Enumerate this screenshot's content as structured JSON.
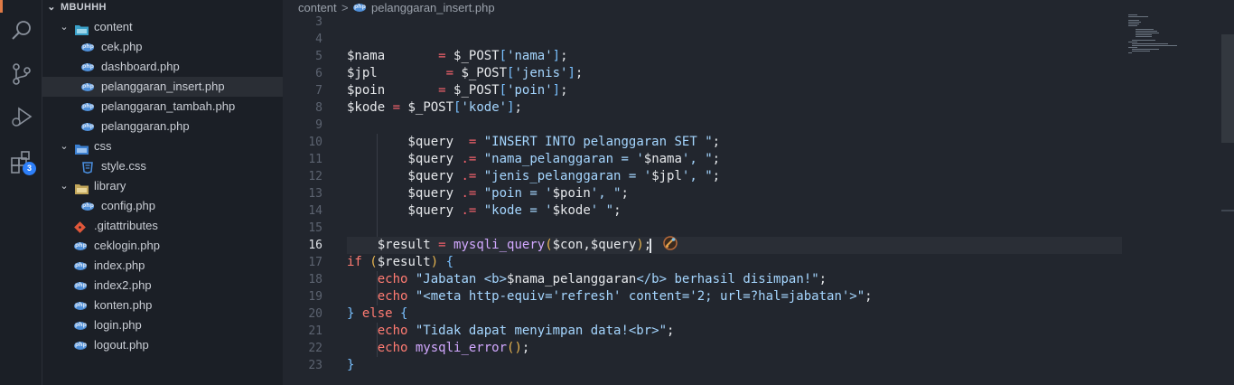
{
  "activity_bar": {
    "icons": [
      "files-icon",
      "search-icon",
      "source-control-icon",
      "run-debug-icon",
      "extensions-icon"
    ],
    "extensions_badge": "3"
  },
  "explorer": {
    "root": "MBUHHH",
    "items": [
      {
        "label": "content",
        "type": "folder",
        "icon": "folder-icon"
      },
      {
        "label": "cek.php",
        "type": "php"
      },
      {
        "label": "dashboard.php",
        "type": "php"
      },
      {
        "label": "pelanggaran_insert.php",
        "type": "php",
        "selected": true
      },
      {
        "label": "pelanggaran_tambah.php",
        "type": "php"
      },
      {
        "label": "pelanggaran.php",
        "type": "php"
      },
      {
        "label": "css",
        "type": "folder"
      },
      {
        "label": "style.css",
        "type": "css"
      },
      {
        "label": "library",
        "type": "folder"
      },
      {
        "label": "config.php",
        "type": "php"
      },
      {
        "label": ".gitattributes",
        "type": "git"
      },
      {
        "label": "ceklogin.php",
        "type": "php"
      },
      {
        "label": "index.php",
        "type": "php"
      },
      {
        "label": "index2.php",
        "type": "php"
      },
      {
        "label": "konten.php",
        "type": "php"
      },
      {
        "label": "login.php",
        "type": "php"
      },
      {
        "label": "logout.php",
        "type": "php"
      }
    ]
  },
  "breadcrumb": {
    "folder": "content",
    "separator": ">",
    "file": "pelanggaran_insert.php"
  },
  "editor": {
    "active_line": "16",
    "line_numbers": [
      "3",
      "4",
      "5",
      "6",
      "7",
      "8",
      "9",
      "10",
      "11",
      "12",
      "13",
      "14",
      "15",
      "16",
      "17",
      "18",
      "19",
      "20",
      "21",
      "22",
      "23"
    ],
    "lines": [
      [],
      [],
      [
        [
          "$nama",
          "var"
        ],
        [
          "       ",
          "var"
        ],
        [
          "=",
          "op"
        ],
        [
          " $_POST",
          "var"
        ],
        [
          "[",
          "br2"
        ],
        [
          "'nama'",
          "str"
        ],
        [
          "]",
          "br2"
        ],
        [
          ";",
          "var"
        ]
      ],
      [
        [
          "$jpl",
          "var"
        ],
        [
          "         ",
          "var"
        ],
        [
          "=",
          "op"
        ],
        [
          " $_POST",
          "var"
        ],
        [
          "[",
          "br2"
        ],
        [
          "'jenis'",
          "str"
        ],
        [
          "]",
          "br2"
        ],
        [
          ";",
          "var"
        ]
      ],
      [
        [
          "$poin",
          "var"
        ],
        [
          "       ",
          "var"
        ],
        [
          "=",
          "op"
        ],
        [
          " $_POST",
          "var"
        ],
        [
          "[",
          "br2"
        ],
        [
          "'poin'",
          "str"
        ],
        [
          "]",
          "br2"
        ],
        [
          ";",
          "var"
        ]
      ],
      [
        [
          "$kode",
          "var"
        ],
        [
          " ",
          "var"
        ],
        [
          "=",
          "op"
        ],
        [
          " $_POST",
          "var"
        ],
        [
          "[",
          "br2"
        ],
        [
          "'kode'",
          "str"
        ],
        [
          "]",
          "br2"
        ],
        [
          ";",
          "var"
        ]
      ],
      [],
      [
        [
          "        $query",
          "var"
        ],
        [
          "  ",
          "var"
        ],
        [
          "=",
          "op"
        ],
        [
          " ",
          "var"
        ],
        [
          "\"INSERT INTO ",
          "str"
        ],
        [
          "pelanggaran",
          "str"
        ],
        [
          " SET \"",
          "str"
        ],
        [
          ";",
          "var"
        ]
      ],
      [
        [
          "        $query",
          "var"
        ],
        [
          " ",
          "var"
        ],
        [
          ".=",
          "op"
        ],
        [
          " ",
          "var"
        ],
        [
          "\"nama_pelanggaran = '",
          "str"
        ],
        [
          "$nama",
          "var"
        ],
        [
          "', \"",
          "str"
        ],
        [
          ";",
          "var"
        ]
      ],
      [
        [
          "        $query",
          "var"
        ],
        [
          " ",
          "var"
        ],
        [
          ".=",
          "op"
        ],
        [
          " ",
          "var"
        ],
        [
          "\"jenis_pelanggaran = '",
          "str"
        ],
        [
          "$jpl",
          "var"
        ],
        [
          "', \"",
          "str"
        ],
        [
          ";",
          "var"
        ]
      ],
      [
        [
          "        $query",
          "var"
        ],
        [
          " ",
          "var"
        ],
        [
          ".=",
          "op"
        ],
        [
          " ",
          "var"
        ],
        [
          "\"poin = '",
          "str"
        ],
        [
          "$poin",
          "var"
        ],
        [
          "', \"",
          "str"
        ],
        [
          ";",
          "var"
        ]
      ],
      [
        [
          "        $query",
          "var"
        ],
        [
          " ",
          "var"
        ],
        [
          ".=",
          "op"
        ],
        [
          " ",
          "var"
        ],
        [
          "\"kode = '",
          "str"
        ],
        [
          "$kode",
          "var"
        ],
        [
          "' \"",
          "str"
        ],
        [
          ";",
          "var"
        ]
      ],
      [],
      [
        [
          "    $result",
          "var"
        ],
        [
          " ",
          "var"
        ],
        [
          "=",
          "op"
        ],
        [
          " ",
          "var"
        ],
        [
          "mysqli_query",
          "fn"
        ],
        [
          "(",
          "br"
        ],
        [
          "$con,$query",
          "var"
        ],
        [
          ")",
          "br"
        ],
        [
          ";",
          "var"
        ]
      ],
      [
        [
          "if",
          "kw"
        ],
        [
          " ",
          "var"
        ],
        [
          "(",
          "br"
        ],
        [
          "$result",
          "var"
        ],
        [
          ")",
          "br"
        ],
        [
          " ",
          "var"
        ],
        [
          "{",
          "br2"
        ]
      ],
      [
        [
          "    echo",
          "kw"
        ],
        [
          " ",
          "var"
        ],
        [
          "\"Jabatan <b>",
          "str"
        ],
        [
          "$nama_pelanggaran",
          "var"
        ],
        [
          "</b> berhasil disimpan!\"",
          "str"
        ],
        [
          ";",
          "var"
        ]
      ],
      [
        [
          "    echo",
          "kw"
        ],
        [
          " ",
          "var"
        ],
        [
          "\"<meta http-equiv='refresh' content='2; url=?hal=jabatan'>\"",
          "str"
        ],
        [
          ";",
          "var"
        ]
      ],
      [
        [
          "}",
          "br2"
        ],
        [
          " ",
          "var"
        ],
        [
          "else",
          "kw"
        ],
        [
          " ",
          "var"
        ],
        [
          "{",
          "br2"
        ]
      ],
      [
        [
          "    echo",
          "kw"
        ],
        [
          " ",
          "var"
        ],
        [
          "\"Tidak dapat menyimpan data!<br>\"",
          "str"
        ],
        [
          ";",
          "var"
        ]
      ],
      [
        [
          "    echo",
          "kw"
        ],
        [
          " ",
          "var"
        ],
        [
          "mysqli_error",
          "fn"
        ],
        [
          "(",
          "br"
        ],
        [
          ")",
          "br"
        ],
        [
          ";",
          "var"
        ]
      ],
      [
        [
          "}",
          "br2"
        ]
      ]
    ]
  }
}
